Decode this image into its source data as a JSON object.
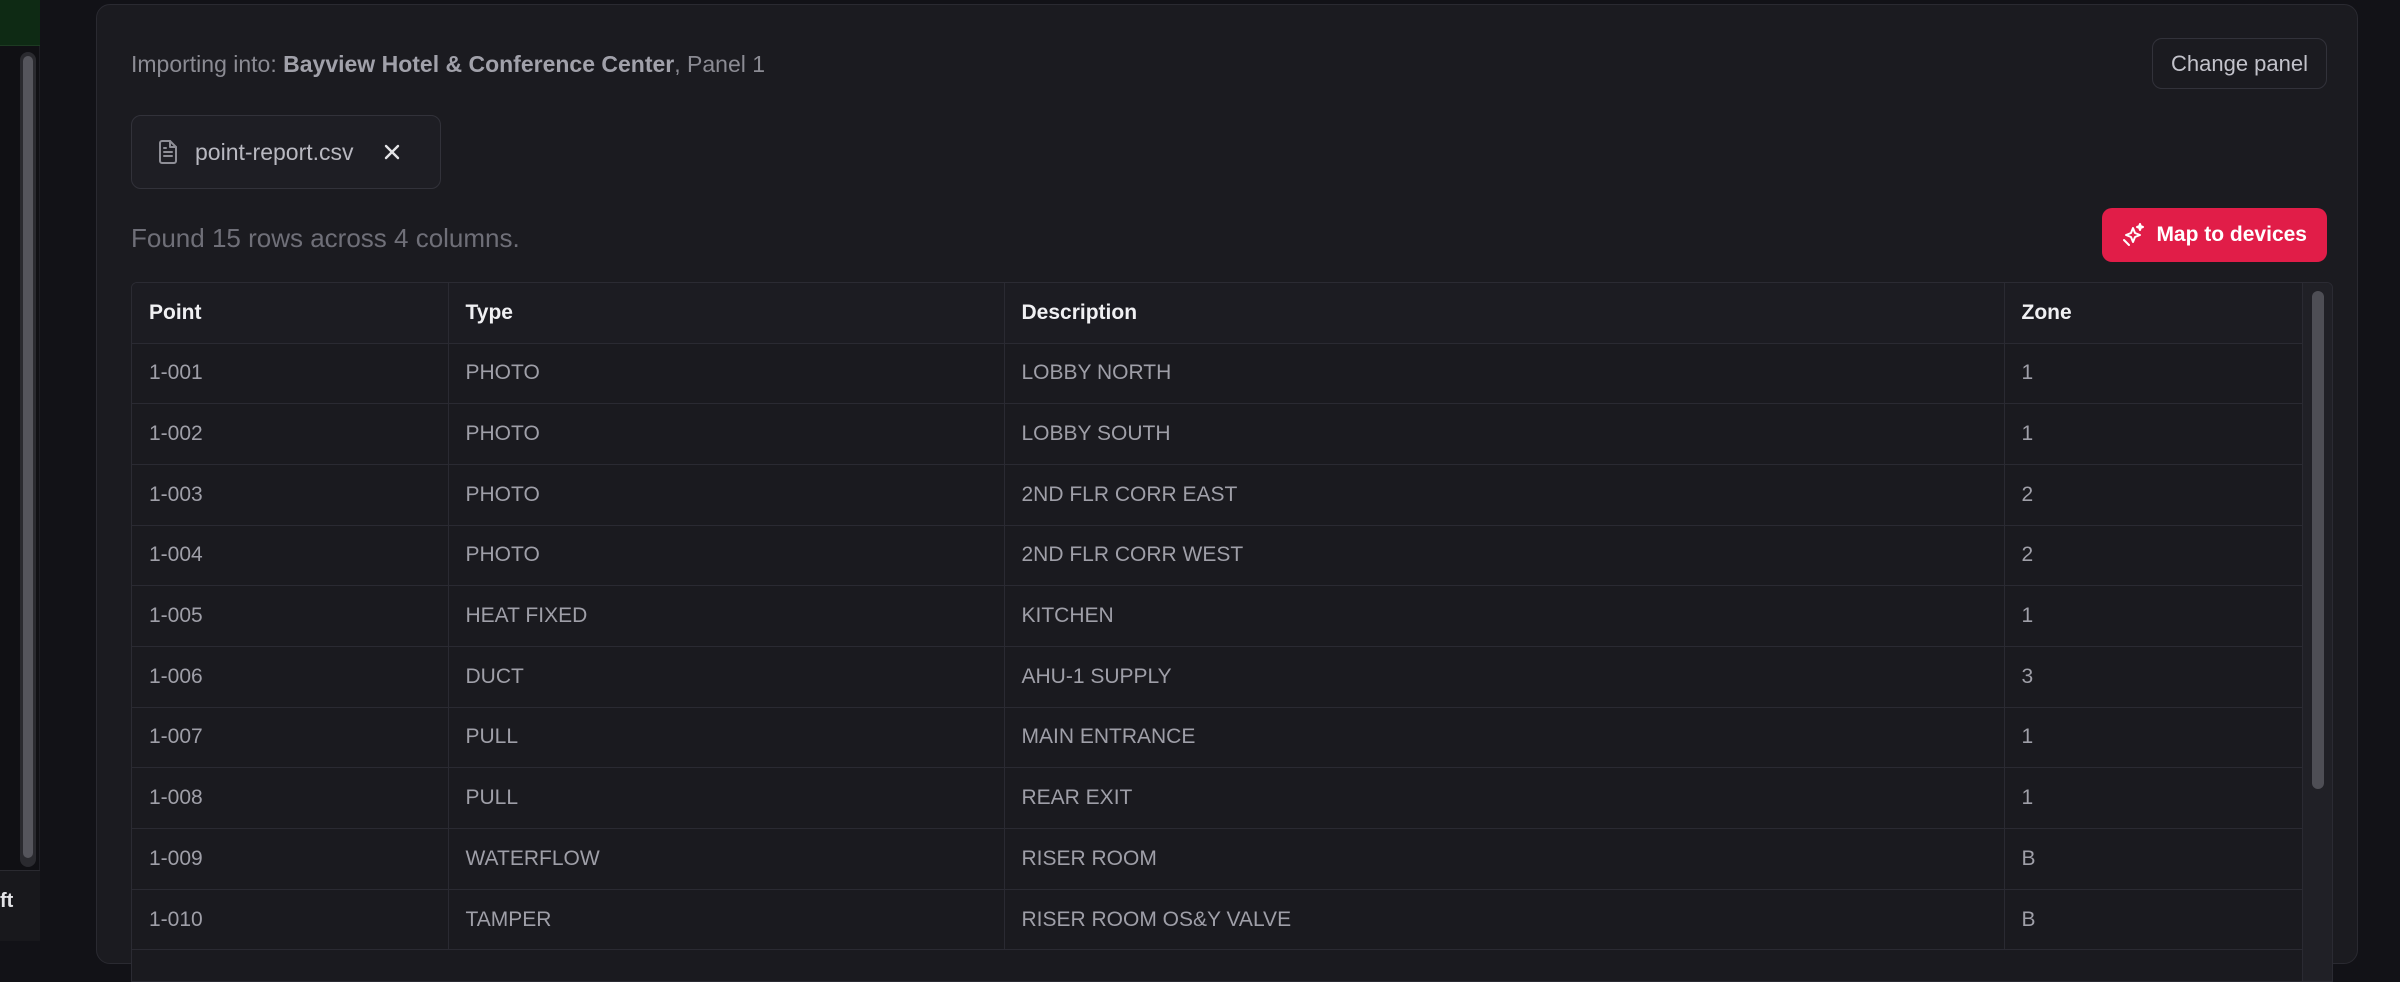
{
  "sidebar": {
    "bottom_text": "ft"
  },
  "panel": {
    "importing_prefix": "Importing into: ",
    "site_name": "Bayview Hotel & Conference Center",
    "panel_suffix": ", Panel 1",
    "change_panel_label": "Change panel",
    "file": {
      "name": "point-report.csv",
      "icon": "file-text-icon",
      "remove_icon": "close-icon"
    },
    "found_text": "Found 15 rows across 4 columns.",
    "map_button_label": "Map to devices",
    "map_button_icon": "sparkles-icon",
    "accent_color": "#e11d48"
  },
  "table": {
    "columns": [
      "Point",
      "Type",
      "Description",
      "Zone"
    ],
    "rows": [
      [
        "1-001",
        "PHOTO",
        "LOBBY NORTH",
        "1"
      ],
      [
        "1-002",
        "PHOTO",
        "LOBBY SOUTH",
        "1"
      ],
      [
        "1-003",
        "PHOTO",
        "2ND FLR CORR EAST",
        "2"
      ],
      [
        "1-004",
        "PHOTO",
        "2ND FLR CORR WEST",
        "2"
      ],
      [
        "1-005",
        "HEAT FIXED",
        "KITCHEN",
        "1"
      ],
      [
        "1-006",
        "DUCT",
        "AHU-1 SUPPLY",
        "3"
      ],
      [
        "1-007",
        "PULL",
        "MAIN ENTRANCE",
        "1"
      ],
      [
        "1-008",
        "PULL",
        "REAR EXIT",
        "1"
      ],
      [
        "1-009",
        "WATERFLOW",
        "RISER ROOM",
        "B"
      ],
      [
        "1-010",
        "TAMPER",
        "RISER ROOM OS&Y VALVE",
        "B"
      ]
    ]
  }
}
